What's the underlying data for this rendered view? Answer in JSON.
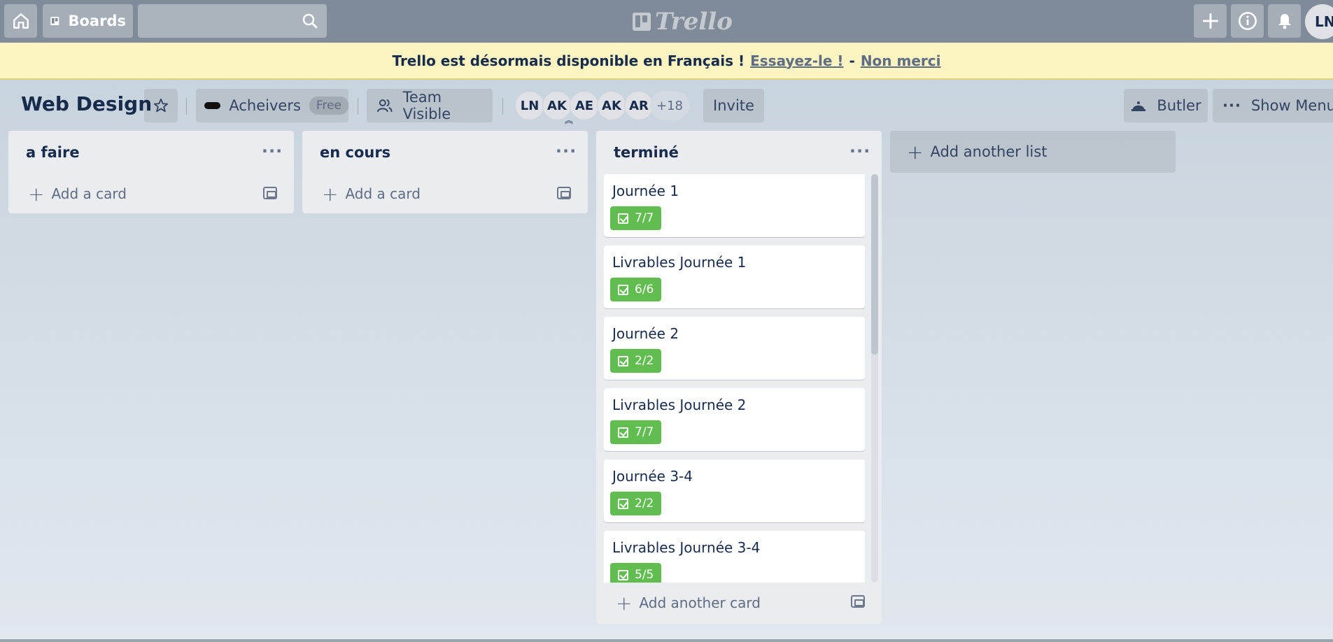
{
  "header": {
    "boards_label": "Boards",
    "logo_text": "Trello",
    "user_initials": "LN"
  },
  "banner": {
    "message": "Trello est désormais disponible en Français !",
    "try_link": "Essayez-le !",
    "separator": "-",
    "dismiss_link": "Non merci"
  },
  "board": {
    "title": "Web Design",
    "team_name": "Acheivers",
    "team_plan": "Free",
    "visibility": "Team Visible",
    "members": [
      "LN",
      "AK",
      "AE",
      "AK",
      "AR"
    ],
    "members_more": "+18",
    "invite_label": "Invite",
    "butler_label": "Butler",
    "show_menu_label": "Show Menu"
  },
  "lists": [
    {
      "title": "a faire",
      "menu": "···",
      "add_card": "Add a card",
      "cards": []
    },
    {
      "title": "en cours",
      "menu": "···",
      "add_card": "Add a card",
      "cards": []
    },
    {
      "title": "terminé",
      "menu": "···",
      "add_card": "Add another card",
      "cards": [
        {
          "title": "Journée 1",
          "checklist": "7/7"
        },
        {
          "title": "Livrables Journée 1",
          "checklist": "6/6"
        },
        {
          "title": "Journée 2",
          "checklist": "2/2"
        },
        {
          "title": "Livrables Journée 2",
          "checklist": "7/7"
        },
        {
          "title": "Journée 3-4",
          "checklist": "2/2"
        },
        {
          "title": "Livrables Journée 3-4",
          "checklist": "5/5"
        }
      ]
    }
  ],
  "add_list_label": "Add another list",
  "colors": {
    "header_bg": "#7f8b98",
    "banner_bg": "#fbf3c0",
    "list_bg": "#ebecf0",
    "checklist_complete": "#61bd4f",
    "text_primary": "#172b4d"
  }
}
